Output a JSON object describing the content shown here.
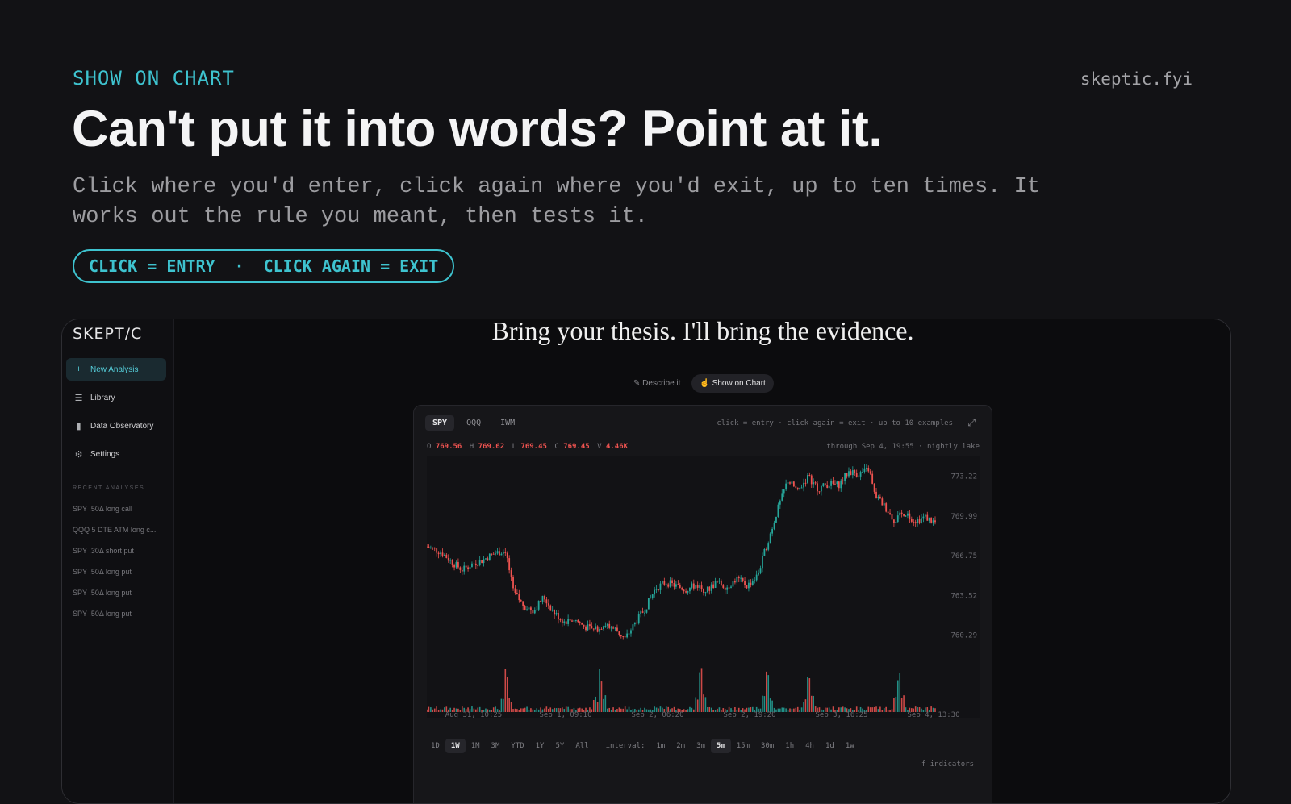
{
  "hero": {
    "eyebrow": "SHOW ON CHART",
    "domain": "skeptic.fyi",
    "headline": "Can't put it into words? Point at it.",
    "sub": "Click where you'd enter, click again where you'd exit, up to ten times. It works out the rule you meant, then tests it.",
    "pill_a": "CLICK = ENTRY",
    "pill_sep": "·",
    "pill_b": "CLICK AGAIN = EXIT"
  },
  "app": {
    "logo": "SKEPT/C",
    "nav": [
      {
        "label": "New Analysis",
        "icon": "plus-icon",
        "glyph": "+"
      },
      {
        "label": "Library",
        "icon": "library-icon",
        "glyph": "☰"
      },
      {
        "label": "Data Observatory",
        "icon": "bar-chart-icon",
        "glyph": "▮"
      },
      {
        "label": "Settings",
        "icon": "sliders-icon",
        "glyph": "⚙"
      }
    ],
    "recent_heading": "RECENT ANALYSES",
    "recent": [
      "SPY .50Δ long call",
      "QQQ 5 DTE ATM long c...",
      "SPY .30Δ short put",
      "SPY .50Δ long put",
      "SPY .50Δ long put",
      "SPY .50Δ long put"
    ],
    "thesis": "Bring your thesis. I'll bring the evidence.",
    "toggle": {
      "describe": "Describe it",
      "show": "Show on Chart",
      "describe_glyph": "✎",
      "show_glyph": "☝"
    }
  },
  "chart_panel": {
    "tickers": [
      "SPY",
      "QQQ",
      "IWM"
    ],
    "selected_ticker": "SPY",
    "hint": "click = entry · click again = exit · up to 10 examples",
    "expand_glyph": "⤢",
    "ohlc": {
      "o_label": "O",
      "o": "769.56",
      "h_label": "H",
      "h": "769.62",
      "l_label": "L",
      "l": "769.45",
      "c_label": "C",
      "c": "769.45",
      "v_label": "V",
      "v": "4.46K"
    },
    "through": "through Sep 4, 19:55 · nightly lake",
    "ranges": [
      "1D",
      "1W",
      "1M",
      "3M",
      "YTD",
      "1Y",
      "5Y",
      "All"
    ],
    "selected_range": "1W",
    "interval_label": "interval:",
    "intervals": [
      "1m",
      "2m",
      "3m",
      "5m",
      "15m",
      "30m",
      "1h",
      "4h",
      "1d",
      "1w"
    ],
    "selected_interval": "5m",
    "indicators": "f indicators"
  },
  "chart_data": {
    "type": "candlestick",
    "x_tick_labels": [
      "Aug 31, 10:25",
      "Sep 1, 09:10",
      "Sep 2, 06:20",
      "Sep 2, 19:20",
      "Sep 3, 16:25",
      "Sep 4, 13:30"
    ],
    "y_tick_labels": [
      "773.22",
      "769.99",
      "766.75",
      "763.52",
      "760.29"
    ],
    "ylim": [
      758.5,
      774.5
    ],
    "colors": {
      "up": "#26a69a",
      "down": "#ef5350"
    },
    "close_path": [
      [
        0,
        767.5
      ],
      [
        0.03,
        767.0
      ],
      [
        0.05,
        766.2
      ],
      [
        0.07,
        765.6
      ],
      [
        0.09,
        766.1
      ],
      [
        0.11,
        766.4
      ],
      [
        0.13,
        766.9
      ],
      [
        0.155,
        767.2
      ],
      [
        0.17,
        763.8
      ],
      [
        0.19,
        762.7
      ],
      [
        0.21,
        762.3
      ],
      [
        0.23,
        763.4
      ],
      [
        0.25,
        762.1
      ],
      [
        0.27,
        761.4
      ],
      [
        0.29,
        761.6
      ],
      [
        0.31,
        761.0
      ],
      [
        0.33,
        760.7
      ],
      [
        0.35,
        761.2
      ],
      [
        0.37,
        760.8
      ],
      [
        0.39,
        760.0
      ],
      [
        0.41,
        761.3
      ],
      [
        0.43,
        762.5
      ],
      [
        0.45,
        764.1
      ],
      [
        0.47,
        764.6
      ],
      [
        0.49,
        764.3
      ],
      [
        0.51,
        764.0
      ],
      [
        0.53,
        764.4
      ],
      [
        0.55,
        763.9
      ],
      [
        0.57,
        764.6
      ],
      [
        0.59,
        764.2
      ],
      [
        0.61,
        764.9
      ],
      [
        0.63,
        764.3
      ],
      [
        0.65,
        765.1
      ],
      [
        0.67,
        767.8
      ],
      [
        0.69,
        770.5
      ],
      [
        0.71,
        772.9
      ],
      [
        0.73,
        772.0
      ],
      [
        0.75,
        773.2
      ],
      [
        0.77,
        772.2
      ],
      [
        0.79,
        772.6
      ],
      [
        0.81,
        772.5
      ],
      [
        0.83,
        773.6
      ],
      [
        0.85,
        773.4
      ],
      [
        0.87,
        773.8
      ],
      [
        0.88,
        771.8
      ],
      [
        0.9,
        770.8
      ],
      [
        0.92,
        769.6
      ],
      [
        0.94,
        770.3
      ],
      [
        0.96,
        769.6
      ],
      [
        0.98,
        769.9
      ],
      [
        1.0,
        769.45
      ]
    ],
    "volume_spikes": [
      0.155,
      0.34,
      0.54,
      0.67,
      0.75,
      0.93
    ]
  }
}
